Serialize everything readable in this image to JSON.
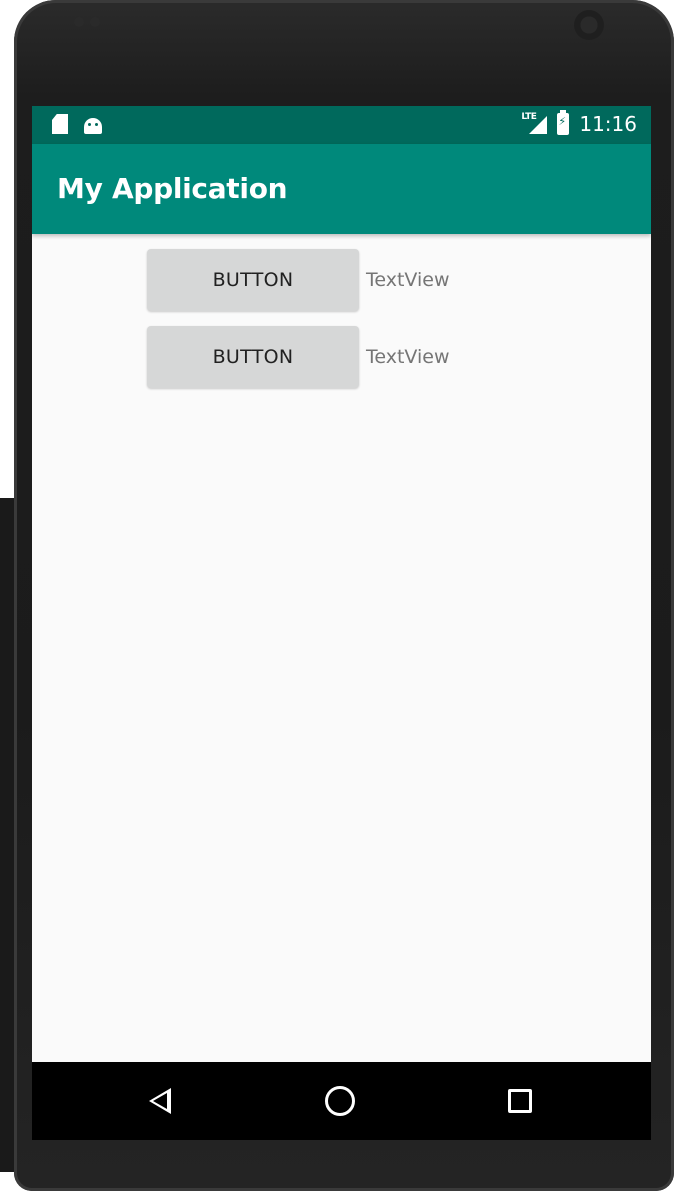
{
  "status_bar": {
    "time": "11:16",
    "lte_label": "LTE",
    "icons": [
      "sd-card-icon",
      "android-icon",
      "lte-signal-icon",
      "battery-charging-icon"
    ]
  },
  "app_bar": {
    "title": "My Application"
  },
  "content": {
    "rows": [
      {
        "button_label": "BUTTON",
        "text_view": "TextView"
      },
      {
        "button_label": "BUTTON",
        "text_view": "TextView"
      }
    ]
  },
  "nav_bar": {
    "icons": [
      "back-icon",
      "home-icon",
      "recents-icon"
    ]
  },
  "colors": {
    "status_bar": "#00695c",
    "app_bar": "#00897b",
    "background": "#fafafa",
    "button": "#d6d7d7",
    "nav_bar": "#000000"
  }
}
